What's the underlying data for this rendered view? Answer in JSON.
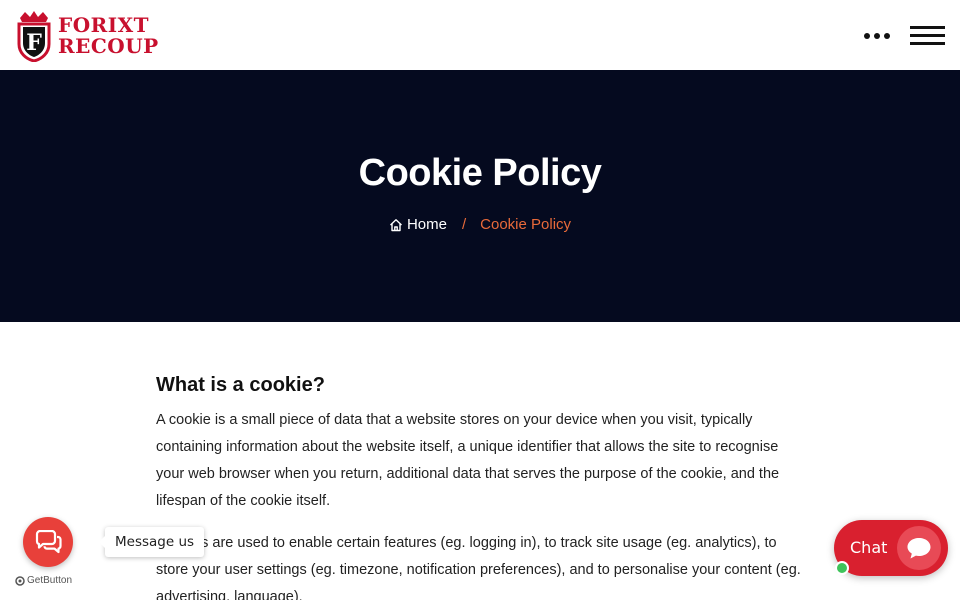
{
  "brand": {
    "line1": "FORIXT",
    "line2": "RECOUP",
    "emblem_letter": "F",
    "color": "#c8102e"
  },
  "header": {
    "more_icon": "dots-horizontal-icon",
    "menu_icon": "hamburger-menu-icon"
  },
  "hero": {
    "title": "Cookie Policy",
    "background": "#050a1f",
    "breadcrumb": {
      "home_icon": "home-icon",
      "home_label": "Home",
      "separator": "/",
      "current": "Cookie Policy",
      "accent": "#e86a3a"
    }
  },
  "content": {
    "heading": "What is a cookie?",
    "paragraph1": "A cookie is a small piece of data that a website stores on your device when you visit, typically containing information about the website itself, a unique identifier that allows the site to recognise your web browser when you return, additional data that serves the purpose of the cookie, and the lifespan of the cookie itself.",
    "paragraph2": "Cookies are used to enable certain features (eg. logging in), to track site usage (eg. analytics), to store your user settings (eg. timezone, notification preferences), and to personalise your content (eg. advertising, language)."
  },
  "message_widget": {
    "label": "Message us",
    "icon": "chat-bubbles-icon",
    "credit": "GetButton",
    "color": "#e8403a"
  },
  "chat_widget": {
    "label": "Chat",
    "icon": "speech-bubble-icon",
    "status": "online",
    "color": "#d9202f"
  }
}
